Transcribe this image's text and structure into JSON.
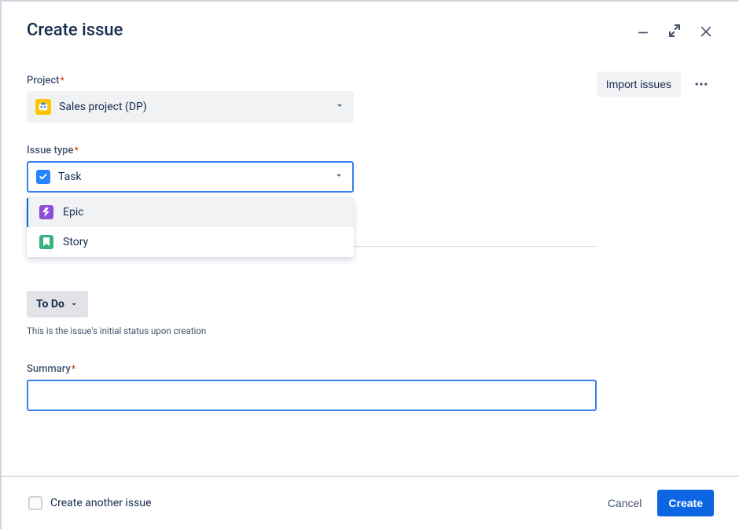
{
  "title": "Create issue",
  "actions": {
    "import_label": "Import issues"
  },
  "fields": {
    "project": {
      "label": "Project",
      "value": "Sales project (DP)"
    },
    "issue_type": {
      "label": "Issue type",
      "value": "Task",
      "options": [
        {
          "label": "Epic"
        },
        {
          "label": "Story"
        }
      ]
    },
    "status": {
      "value": "To Do",
      "helper": "This is the issue's initial status upon creation"
    },
    "summary": {
      "label": "Summary",
      "value": ""
    }
  },
  "footer": {
    "create_another": "Create another issue",
    "cancel": "Cancel",
    "create": "Create"
  }
}
